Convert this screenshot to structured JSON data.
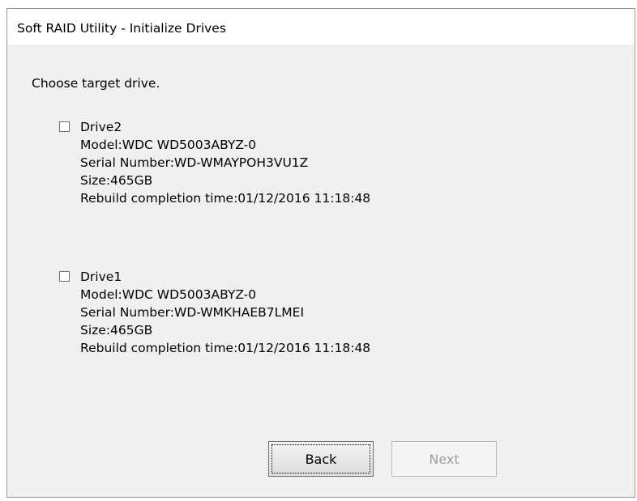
{
  "window": {
    "title": "Soft RAID Utility - Initialize Drives"
  },
  "prompt": "Choose target drive.",
  "drives": [
    {
      "name": "Drive2",
      "checked": false,
      "model": "Model:WDC WD5003ABYZ-0",
      "serial": "Serial Number:WD-WMAYPOH3VU1Z",
      "size": "Size:465GB",
      "rebuild": "Rebuild completion time:01/12/2016 11:18:48"
    },
    {
      "name": "Drive1",
      "checked": false,
      "model": "Model:WDC WD5003ABYZ-0",
      "serial": "Serial Number:WD-WMKHAEB7LMEI",
      "size": "Size:465GB",
      "rebuild": "Rebuild completion time:01/12/2016 11:18:48"
    }
  ],
  "buttons": {
    "back": "Back",
    "next": "Next",
    "next_enabled": false
  }
}
